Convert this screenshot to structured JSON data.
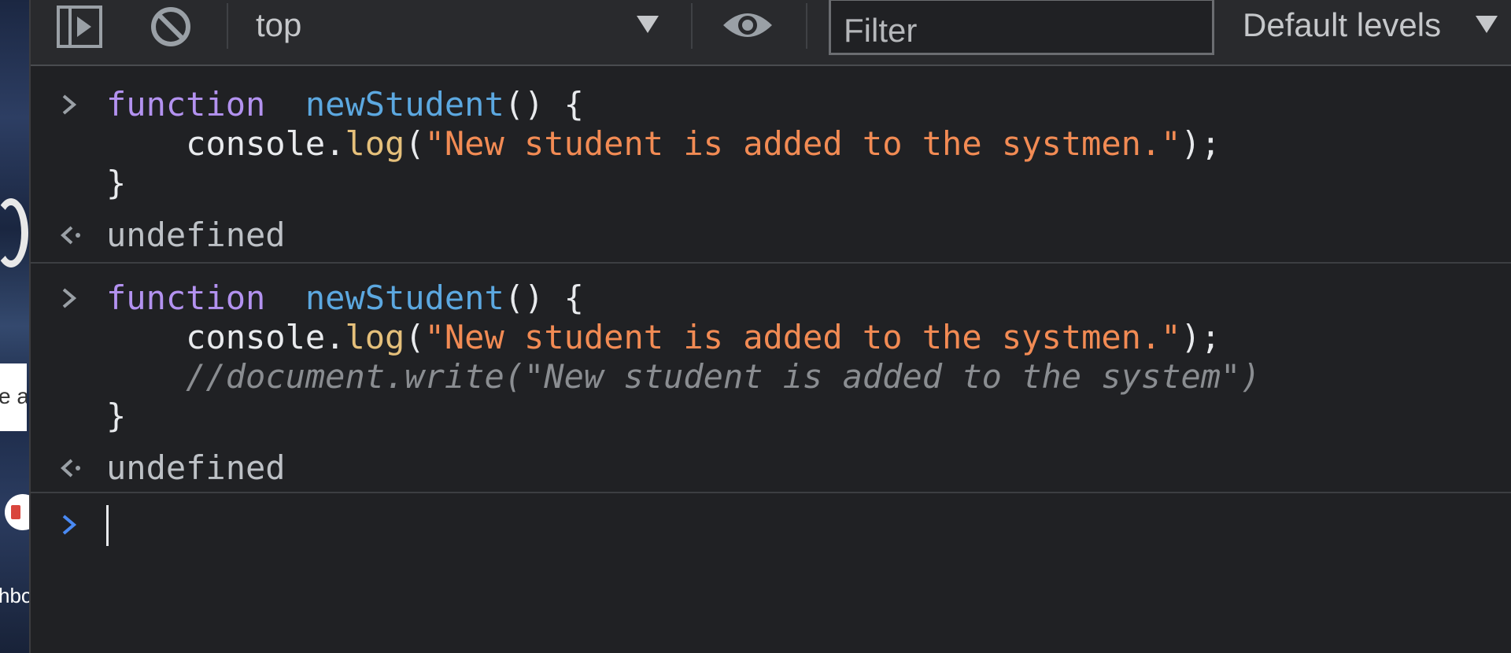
{
  "toolbar": {
    "context_label": "top",
    "filter_placeholder": "Filter",
    "levels_label": "Default levels"
  },
  "background_fragments": {
    "card_text": "e a",
    "bottom_text": "hbo"
  },
  "console": {
    "entries": [
      {
        "input": {
          "line1": {
            "kw": "function",
            "fn": "newStudent",
            "rest": "() {"
          },
          "line2": {
            "obj": "console.",
            "method": "log",
            "open": "(",
            "string": "\"New student is added to the systmen.\"",
            "close": ");"
          },
          "line3": "}"
        },
        "result": "undefined"
      },
      {
        "input": {
          "line1": {
            "kw": "function",
            "fn": "newStudent",
            "rest": "() {"
          },
          "line2": {
            "obj": "console.",
            "method": "log",
            "open": "(",
            "string": "\"New student is added to the systmen.\"",
            "close": ");"
          },
          "comment": "//document.write(\"New student is added to the system\")",
          "line4": "}"
        },
        "result": "undefined"
      }
    ],
    "prompt_value": ""
  },
  "colors": {
    "keyword": "#b392f0",
    "function_name": "#5ca8e0",
    "string": "#f28b54",
    "method": "#e5c07b",
    "comment": "#8a8d91",
    "prompt_active": "#4a8af4"
  },
  "icons": {
    "sidebar_toggle": "sidebar-toggle-icon",
    "clear": "clear-console-icon",
    "live_expression": "eye-icon",
    "prompt": "chevron-right-icon",
    "result": "result-arrow-icon"
  }
}
